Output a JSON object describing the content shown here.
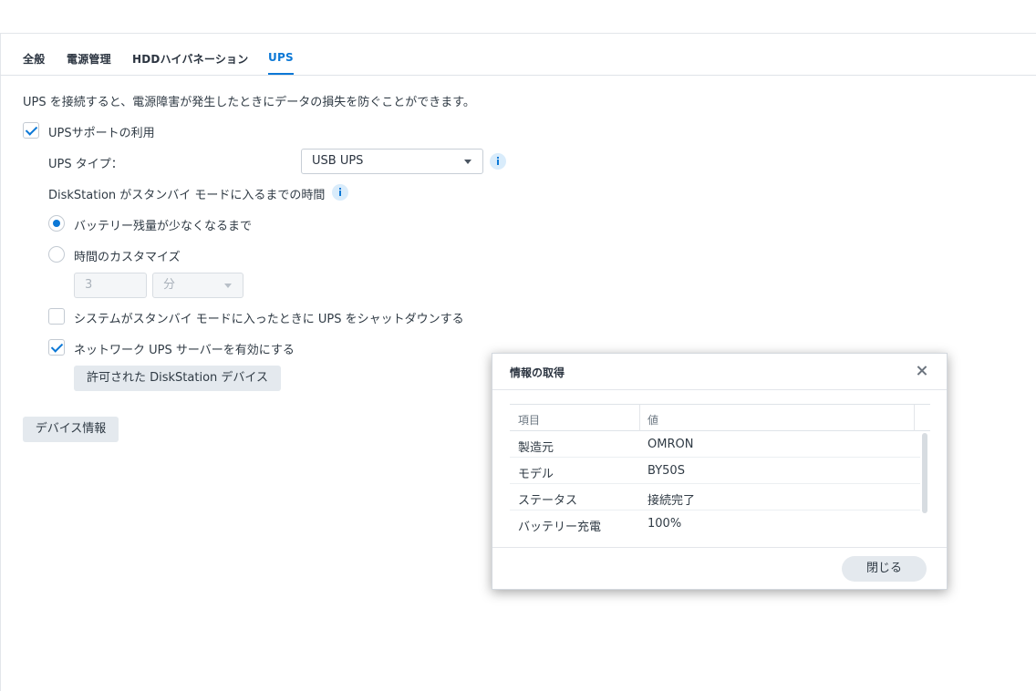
{
  "tabs": [
    {
      "label": "全般"
    },
    {
      "label": "電源管理"
    },
    {
      "label": "HDDハイバネーション"
    },
    {
      "label": "UPS"
    }
  ],
  "active_tab": "UPS",
  "description": "UPS を接続すると、電源障害が発生したときにデータの損失を防ぐことができます。",
  "ups_support": {
    "label": "UPSサポートの利用",
    "checked": true
  },
  "ups_type": {
    "label": "UPS タイプ：",
    "value": "USB UPS"
  },
  "standby": {
    "label": "DiskStation がスタンバイ モードに入るまでの時間",
    "option_low_battery": "バッテリー残量が少なくなるまで",
    "option_custom": "時間のカスタマイズ",
    "custom_value": "3",
    "custom_unit": "分"
  },
  "shutdown_ups": {
    "label": "システムがスタンバイ モードに入ったときに UPS をシャットダウンする",
    "checked": false
  },
  "network_ups": {
    "label": "ネットワーク UPS サーバーを有効にする",
    "checked": true
  },
  "buttons": {
    "allowed_devices": "許可された DiskStation デバイス",
    "device_info": "デバイス情報"
  },
  "dialog": {
    "title": "情報の取得",
    "columns": [
      "項目",
      "値"
    ],
    "rows": [
      {
        "item": "製造元",
        "value": "OMRON"
      },
      {
        "item": "モデル",
        "value": "BY50S"
      },
      {
        "item": "ステータス",
        "value": "接続完了"
      },
      {
        "item": "バッテリー充電",
        "value": "100%"
      }
    ],
    "close_label": "閉じる"
  },
  "colors": {
    "accent": "#0c78d6",
    "button_bg": "#e4e9ee"
  }
}
